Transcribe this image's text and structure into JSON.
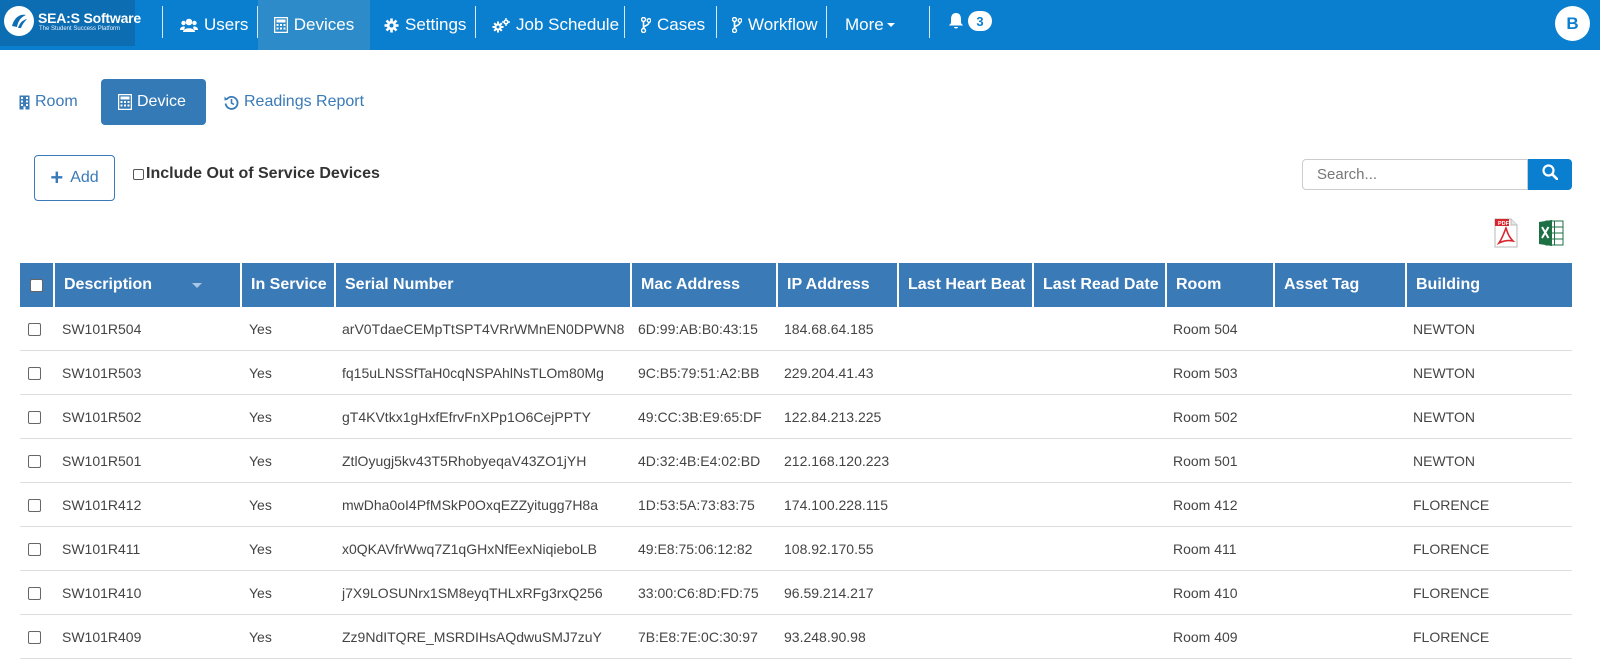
{
  "brand": {
    "name": "SEA:S Software",
    "tagline": "The Student Success Platform"
  },
  "nav": {
    "items": [
      {
        "label": "Users",
        "icon": "users-icon"
      },
      {
        "label": "Devices",
        "icon": "calculator-icon",
        "active": true
      },
      {
        "label": "Settings",
        "icon": "gear-icon"
      },
      {
        "label": "Job Schedule",
        "icon": "gears-icon"
      },
      {
        "label": "Cases",
        "icon": "branch-icon"
      },
      {
        "label": "Workflow",
        "icon": "branch-icon"
      },
      {
        "label": "More",
        "icon": "caret-down-icon"
      }
    ],
    "notification_count": "3",
    "user_initial": "B"
  },
  "tabs": [
    {
      "label": "Room",
      "icon": "building-icon"
    },
    {
      "label": "Device",
      "icon": "calculator-icon",
      "active": true
    },
    {
      "label": "Readings Report",
      "icon": "history-icon"
    }
  ],
  "toolbar": {
    "add_label": "Add",
    "out_of_service_label": "Include Out of Service Devices",
    "search_placeholder": "Search..."
  },
  "table": {
    "columns": [
      "Description",
      "In Service",
      "Serial Number",
      "Mac Address",
      "IP Address",
      "Last Heart Beat",
      "Last Read Date",
      "Room",
      "Asset Tag",
      "Building"
    ],
    "rows": [
      [
        "SW101R504",
        "Yes",
        "arV0TdaeCEMpTtSPT4VRrWMnEN0DPWN8",
        "6D:99:AB:B0:43:15",
        "184.68.64.185",
        "",
        "",
        "Room 504",
        "",
        "NEWTON"
      ],
      [
        "SW101R503",
        "Yes",
        "fq15uLNSSfTaH0cqNSPAhlNsTLOm80Mg",
        "9C:B5:79:51:A2:BB",
        "229.204.41.43",
        "",
        "",
        "Room 503",
        "",
        "NEWTON"
      ],
      [
        "SW101R502",
        "Yes",
        "gT4KVtkx1gHxfEfrvFnXPp1O6CejPPTY",
        "49:CC:3B:E9:65:DF",
        "122.84.213.225",
        "",
        "",
        "Room 502",
        "",
        "NEWTON"
      ],
      [
        "SW101R501",
        "Yes",
        "ZtlOyugj5kv43T5RhobyeqaV43ZO1jYH",
        "4D:32:4B:E4:02:BD",
        "212.168.120.223",
        "",
        "",
        "Room 501",
        "",
        "NEWTON"
      ],
      [
        "SW101R412",
        "Yes",
        "mwDha0oI4PfMSkP0OxqEZZyitugg7H8a",
        "1D:53:5A:73:83:75",
        "174.100.228.115",
        "",
        "",
        "Room 412",
        "",
        "FLORENCE"
      ],
      [
        "SW101R411",
        "Yes",
        "x0QKAVfrWwq7Z1qGHxNfEexNiqieboLB",
        "49:E8:75:06:12:82",
        "108.92.170.55",
        "",
        "",
        "Room 411",
        "",
        "FLORENCE"
      ],
      [
        "SW101R410",
        "Yes",
        "j7X9LOSUNrx1SM8eyqTHLxRFg3rxQ256",
        "33:00:C6:8D:FD:75",
        "96.59.214.217",
        "",
        "",
        "Room 410",
        "",
        "FLORENCE"
      ],
      [
        "SW101R409",
        "Yes",
        "Zz9NdITQRE_MSRDIHsAQdwuSMJ7zuY",
        "7B:E8:7E:0C:30:97",
        "93.248.90.98",
        "",
        "",
        "Room 409",
        "",
        "FLORENCE"
      ]
    ]
  }
}
